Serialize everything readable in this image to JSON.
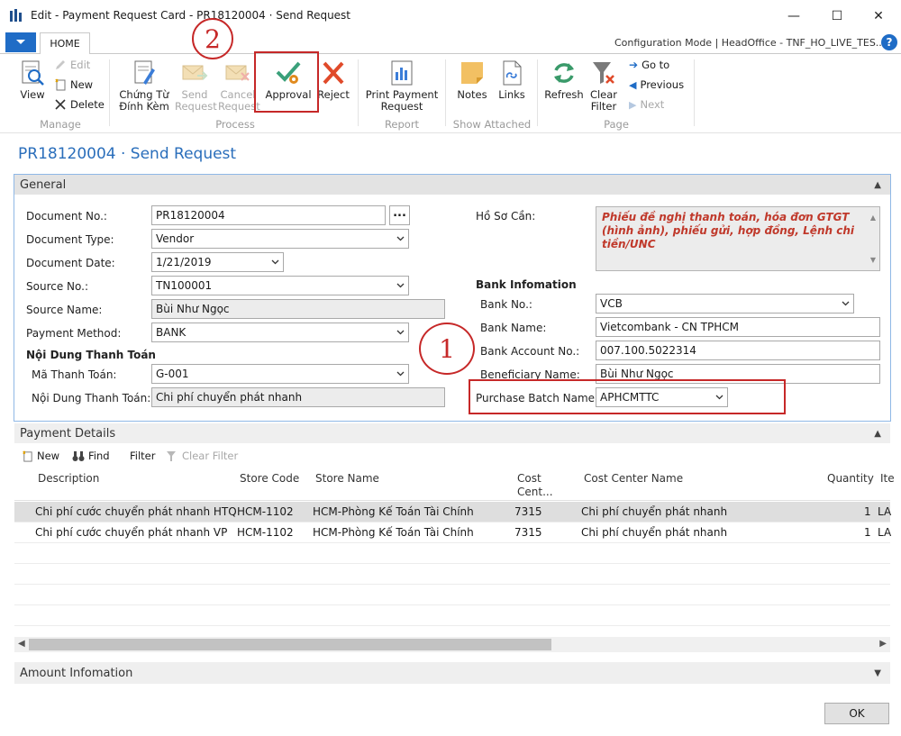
{
  "window": {
    "title": "Edit - Payment Request Card - PR18120004 · Send Request",
    "minimize": "—",
    "maximize": "☐",
    "close": "✕"
  },
  "ribbon": {
    "tab": "HOME",
    "config_text": "Configuration Mode | HeadOffice - TNF_HO_LIVE_TES...",
    "help": "?",
    "manage": {
      "group": "Manage",
      "view": "View",
      "edit": "Edit",
      "new": "New",
      "delete": "Delete"
    },
    "process": {
      "group": "Process",
      "chung_tu": [
        "Chứng Từ",
        "Đính Kèm"
      ],
      "send_request": [
        "Send",
        "Request"
      ],
      "cancel_request": [
        "Cancel",
        "Request"
      ],
      "approval": "Approval",
      "reject": "Reject"
    },
    "report": {
      "group": "Report",
      "print": [
        "Print Payment",
        "Request"
      ]
    },
    "show_attached": {
      "group": "Show Attached",
      "notes": "Notes",
      "links": "Links"
    },
    "page": {
      "group": "Page",
      "refresh": "Refresh",
      "clear_filter": [
        "Clear",
        "Filter"
      ],
      "goto": "Go to",
      "previous": "Previous",
      "next": "Next"
    }
  },
  "annotations": {
    "one": "1",
    "two": "2"
  },
  "page_title": "PR18120004 · Send Request",
  "general": {
    "title": "General",
    "document_no_label": "Document No.:",
    "document_no": "PR18120004",
    "assist": "...",
    "document_type_label": "Document Type:",
    "document_type": "Vendor",
    "document_date_label": "Document Date:",
    "document_date": "1/21/2019",
    "source_no_label": "Source No.:",
    "source_no": "TN100001",
    "source_name_label": "Source Name:",
    "source_name": "Bùi Như Ngọc",
    "payment_method_label": "Payment Method:",
    "payment_method": "BANK",
    "noi_dung_heading": "Nội Dung Thanh Toán",
    "ma_thanh_toan_label": "Mã Thanh Toán:",
    "ma_thanh_toan": "G-001",
    "noi_dung_label": "Nội Dung Thanh Toán:",
    "noi_dung": "Chi phí chuyển phát nhanh",
    "ho_so_label": "Hồ Sơ Cần:",
    "ho_so": "Phiếu đề nghị thanh toán, hóa đơn GTGT (hình ảnh), phiếu gửi, hợp đồng, Lệnh chi tiền/UNC",
    "bank_heading": "Bank Infomation",
    "bank_no_label": "Bank No.:",
    "bank_no": "VCB",
    "bank_name_label": "Bank Name:",
    "bank_name": "Vietcombank - CN TPHCM",
    "bank_account_label": "Bank Account No.:",
    "bank_account": "007.100.5022314",
    "beneficiary_label": "Beneficiary Name:",
    "beneficiary": "Bùi Như Ngọc",
    "purchase_batch_label": "Purchase Batch Name:",
    "purchase_batch": "APHCMTTC"
  },
  "payment_details": {
    "title": "Payment Details",
    "toolbar": {
      "new": "New",
      "find": "Find",
      "filter": "Filter",
      "clear_filter": "Clear Filter"
    },
    "columns": {
      "description": "Description",
      "store_code": "Store Code",
      "store_name": "Store Name",
      "cost_center": [
        "Cost",
        "Cent..."
      ],
      "cost_center_name": "Cost Center Name",
      "quantity": "Quantity",
      "item": "Ite"
    },
    "rows": [
      {
        "description": "Chi phí cước chuyển phát nhanh HTQ",
        "store_code": "HCM-1102",
        "store_name": "HCM-Phòng Kế Toán Tài Chính",
        "cost_center": "7315",
        "cost_center_name": "Chi phí chuyển phát nhanh",
        "quantity": "1",
        "item": "LA"
      },
      {
        "description": "Chi phí cước chuyển phát nhanh VP",
        "store_code": "HCM-1102",
        "store_name": "HCM-Phòng Kế Toán Tài Chính",
        "cost_center": "7315",
        "cost_center_name": "Chi phí chuyển phát nhanh",
        "quantity": "1",
        "item": "LA"
      }
    ]
  },
  "amount": {
    "title": "Amount Infomation"
  },
  "ok": "OK",
  "colors": {
    "accent_blue": "#2a6ebb",
    "annotation_red": "#c62828",
    "memo_red": "#c0392b"
  }
}
